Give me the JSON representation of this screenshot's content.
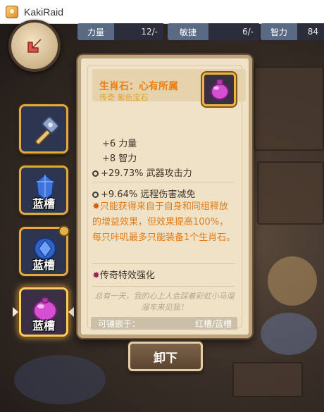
{
  "window": {
    "title": "KakiRaid",
    "icon": "app-icon"
  },
  "stats": [
    {
      "label": "力量",
      "value": "12/-"
    },
    {
      "label": "敏捷",
      "value": "6/-"
    },
    {
      "label": "智力",
      "value": "84"
    }
  ],
  "slots": [
    {
      "icon": "hammer-icon",
      "label": ""
    },
    {
      "icon": "blue-gem-icon",
      "label": "蓝槽"
    },
    {
      "icon": "blue-gem-icon",
      "label": "蓝槽"
    },
    {
      "icon": "purple-gem-icon",
      "label": "蓝槽",
      "selected": true
    }
  ],
  "item": {
    "name": "生肖石：心有所属",
    "subtitle": "传奇 紫色宝石",
    "icon": "purple-gem-icon",
    "bonuses": {
      "strength": "+6 力量",
      "intellect": "+8 智力",
      "weapon_attack": "+29.73% 武器攻击力",
      "ranged_reduction": "+9.64% 远程伤害减免"
    },
    "passive": "只能获得来自于自身和同组释放的增益效果，但效果提高100%，每只咔叽最多只能装备1个生肖石。",
    "legend": "传奇特效强化",
    "flavor": "总有一天，我的心上人会踩着彩虹小马溜溜车来见我！",
    "socket_label": "可镶嵌于：",
    "socket_value": "红槽/蓝槽"
  },
  "actions": {
    "unequip": "卸下"
  },
  "colors": {
    "legendary": "#ee7d14",
    "panel": "#efe2c6",
    "slot_border": "#e6a940"
  }
}
